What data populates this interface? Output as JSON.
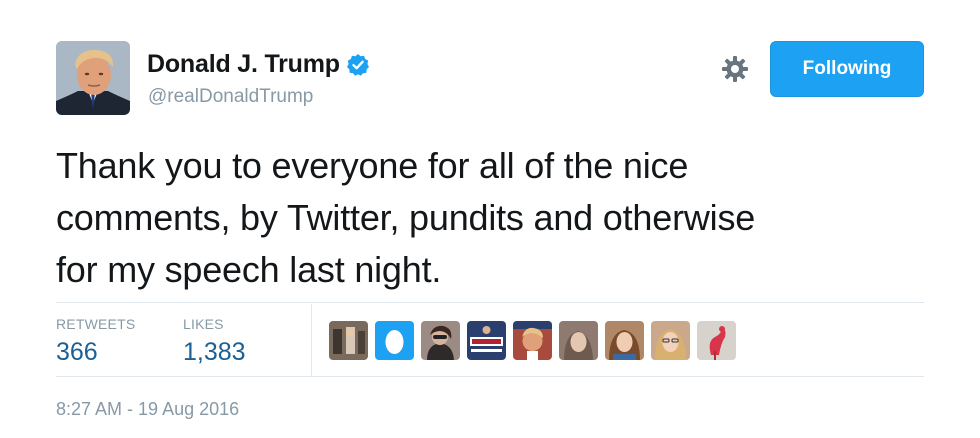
{
  "user": {
    "display_name": "Donald J. Trump",
    "handle": "@realDonaldTrump",
    "verified": true,
    "avatar_icon": "profile-photo"
  },
  "actions": {
    "settings_icon": "gear-icon",
    "follow_label": "Following"
  },
  "tweet": {
    "lines": [
      "Thank you to everyone for all of the nice",
      "comments, by Twitter, pundits and otherwise",
      "for my speech last night."
    ]
  },
  "stats": {
    "retweets_label": "RETWEETS",
    "retweets_count": "366",
    "likes_label": "LIKES",
    "likes_count": "1,383"
  },
  "likers": [
    {
      "color": "#7a6a5c"
    },
    {
      "color": "#1da1f2"
    },
    {
      "color": "#9c8a84"
    },
    {
      "color": "#2b3f6e"
    },
    {
      "color": "#a84a3c"
    },
    {
      "color": "#8f7a72"
    },
    {
      "color": "#b08868"
    },
    {
      "color": "#c9a88c"
    },
    {
      "color": "#d8d2cc"
    }
  ],
  "timestamp": "8:27 AM - 19 Aug 2016",
  "colors": {
    "accent": "#1da1f2",
    "link_count": "#1b5f94",
    "muted": "#8899a6"
  }
}
